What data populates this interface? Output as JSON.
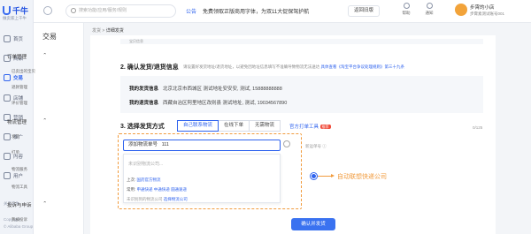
{
  "app": {
    "name": "千牛",
    "slogan": "做卖家上千牛"
  },
  "rail": {
    "items": [
      {
        "label": "首页"
      },
      {
        "label": "商品"
      },
      {
        "label": "交易"
      },
      {
        "label": "店铺"
      },
      {
        "label": "营销"
      },
      {
        "label": "推广"
      },
      {
        "label": "内容"
      },
      {
        "label": "用户"
      }
    ],
    "footer": [
      "关于千牛",
      "Copyright",
      "© Alibaba Group"
    ]
  },
  "submenu": {
    "title": "交易",
    "groups": [
      {
        "label": "订单管理",
        "items": [
          "已卖出的宝贝",
          "退款管理",
          "评价管理"
        ]
      },
      {
        "label": "物流管理",
        "items": [
          "发货",
          "打单",
          "物流服务",
          "物流工具"
        ]
      },
      {
        "label": "投诉与申诉",
        "items": [
          "我被投诉"
        ]
      }
    ]
  },
  "topbar": {
    "search_placeholder": "搜索功能/应用/服务/规则",
    "notice_tag": "公告",
    "notice_text": "免费领取正版商用字体，为双11大促保驾护航",
    "old_version": "返回旧版",
    "help": "帮助",
    "notify": "通知",
    "shop_name": "步霄的小店",
    "shop_sub": "步霄素测试账号001"
  },
  "breadcrumb": {
    "root": "发货",
    "current": "详细发货"
  },
  "section1": {
    "remnant": "宝贝信息"
  },
  "section2": {
    "title": "2. 确认发货/退货信息",
    "tip": "请设置好发货地址/退货地址，以避免因地址信息填写不准确导致物流无法送达",
    "tip_link": "具体查看《淘宝平台争议处理规则》第三十九条",
    "ship_label": "我的发货信息",
    "ship_value": "北京北京市西城区 测试地址安安安, 测试, 15888888888",
    "return_label": "我的退货信息",
    "return_value": "西藏自治区阿里地区改则县 测试地址, 测试, 19034567890"
  },
  "section3": {
    "title": "3. 选择发货方式",
    "tabs": [
      "自己联系物流",
      "在线下单",
      "无需物流"
    ],
    "tool_link": "官方打单工具",
    "tool_badge": "推荐",
    "counter": "0/125",
    "waybill_label": "添加物流单号",
    "waybill_value": "111",
    "dropdown_placeholder": "未识别物流公司...",
    "recent_label": "上次:",
    "recent_value": "国药官方物流",
    "common_label": "常用:",
    "common_values": [
      "申通快递",
      "中通快递",
      "圆通速递"
    ],
    "not_found": "未识别到的物流公司",
    "not_found_link": "选择物流公司",
    "side_label": "新运单号",
    "callout": "自动联想快递公司",
    "confirm": "确认并发货"
  },
  "colors": {
    "accent": "#2f63ee",
    "callout": "#f19b3d",
    "button": "#3a72f0"
  }
}
